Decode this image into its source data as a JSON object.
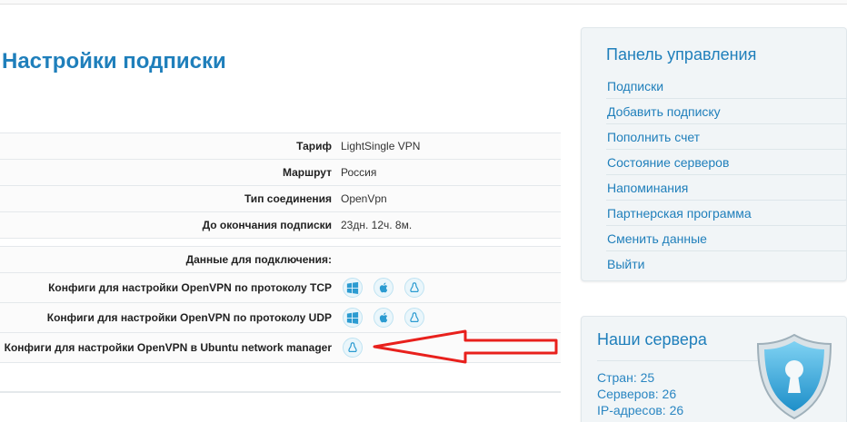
{
  "page": {
    "title": "Настройки подписки"
  },
  "details": {
    "rows": [
      {
        "label": "Тариф",
        "value": "LightSingle VPN"
      },
      {
        "label": "Маршрут",
        "value": "Россия"
      },
      {
        "label": "Тип соединения",
        "value": "OpenVpn"
      },
      {
        "label": "До окончания подписки",
        "value": "23дн. 12ч. 8м."
      }
    ],
    "connection_heading": "Данные для подключения:",
    "configs": [
      {
        "label": "Конфиги для настройки OpenVPN по протоколу TCP",
        "icons": [
          "windows-icon",
          "apple-icon",
          "linux-icon"
        ]
      },
      {
        "label": "Конфиги для настройки OpenVPN по протоколу UDP",
        "icons": [
          "windows-icon",
          "apple-icon",
          "linux-icon"
        ]
      },
      {
        "label": "Конфиги для настройки OpenVPN в Ubuntu network manager",
        "icons": [
          "linux-icon"
        ]
      }
    ]
  },
  "annotation": {
    "arrow_color": "#e8201c"
  },
  "sidebar": {
    "title": "Панель управления",
    "items": [
      {
        "label": "Подписки"
      },
      {
        "label": "Добавить подписку"
      },
      {
        "label": "Пополнить счет"
      },
      {
        "label": "Состояние серверов"
      },
      {
        "label": "Напоминания"
      },
      {
        "label": "Партнерская программа"
      },
      {
        "label": "Сменить данные"
      },
      {
        "label": "Выйти"
      }
    ]
  },
  "servers": {
    "title": "Наши сервера",
    "countries": "Стран: 25",
    "servers": "Серверов: 26",
    "ips": "IP-адресов: 26"
  },
  "colors": {
    "accent": "#1f7fbb",
    "icon_fill": "#2b9bd1"
  }
}
